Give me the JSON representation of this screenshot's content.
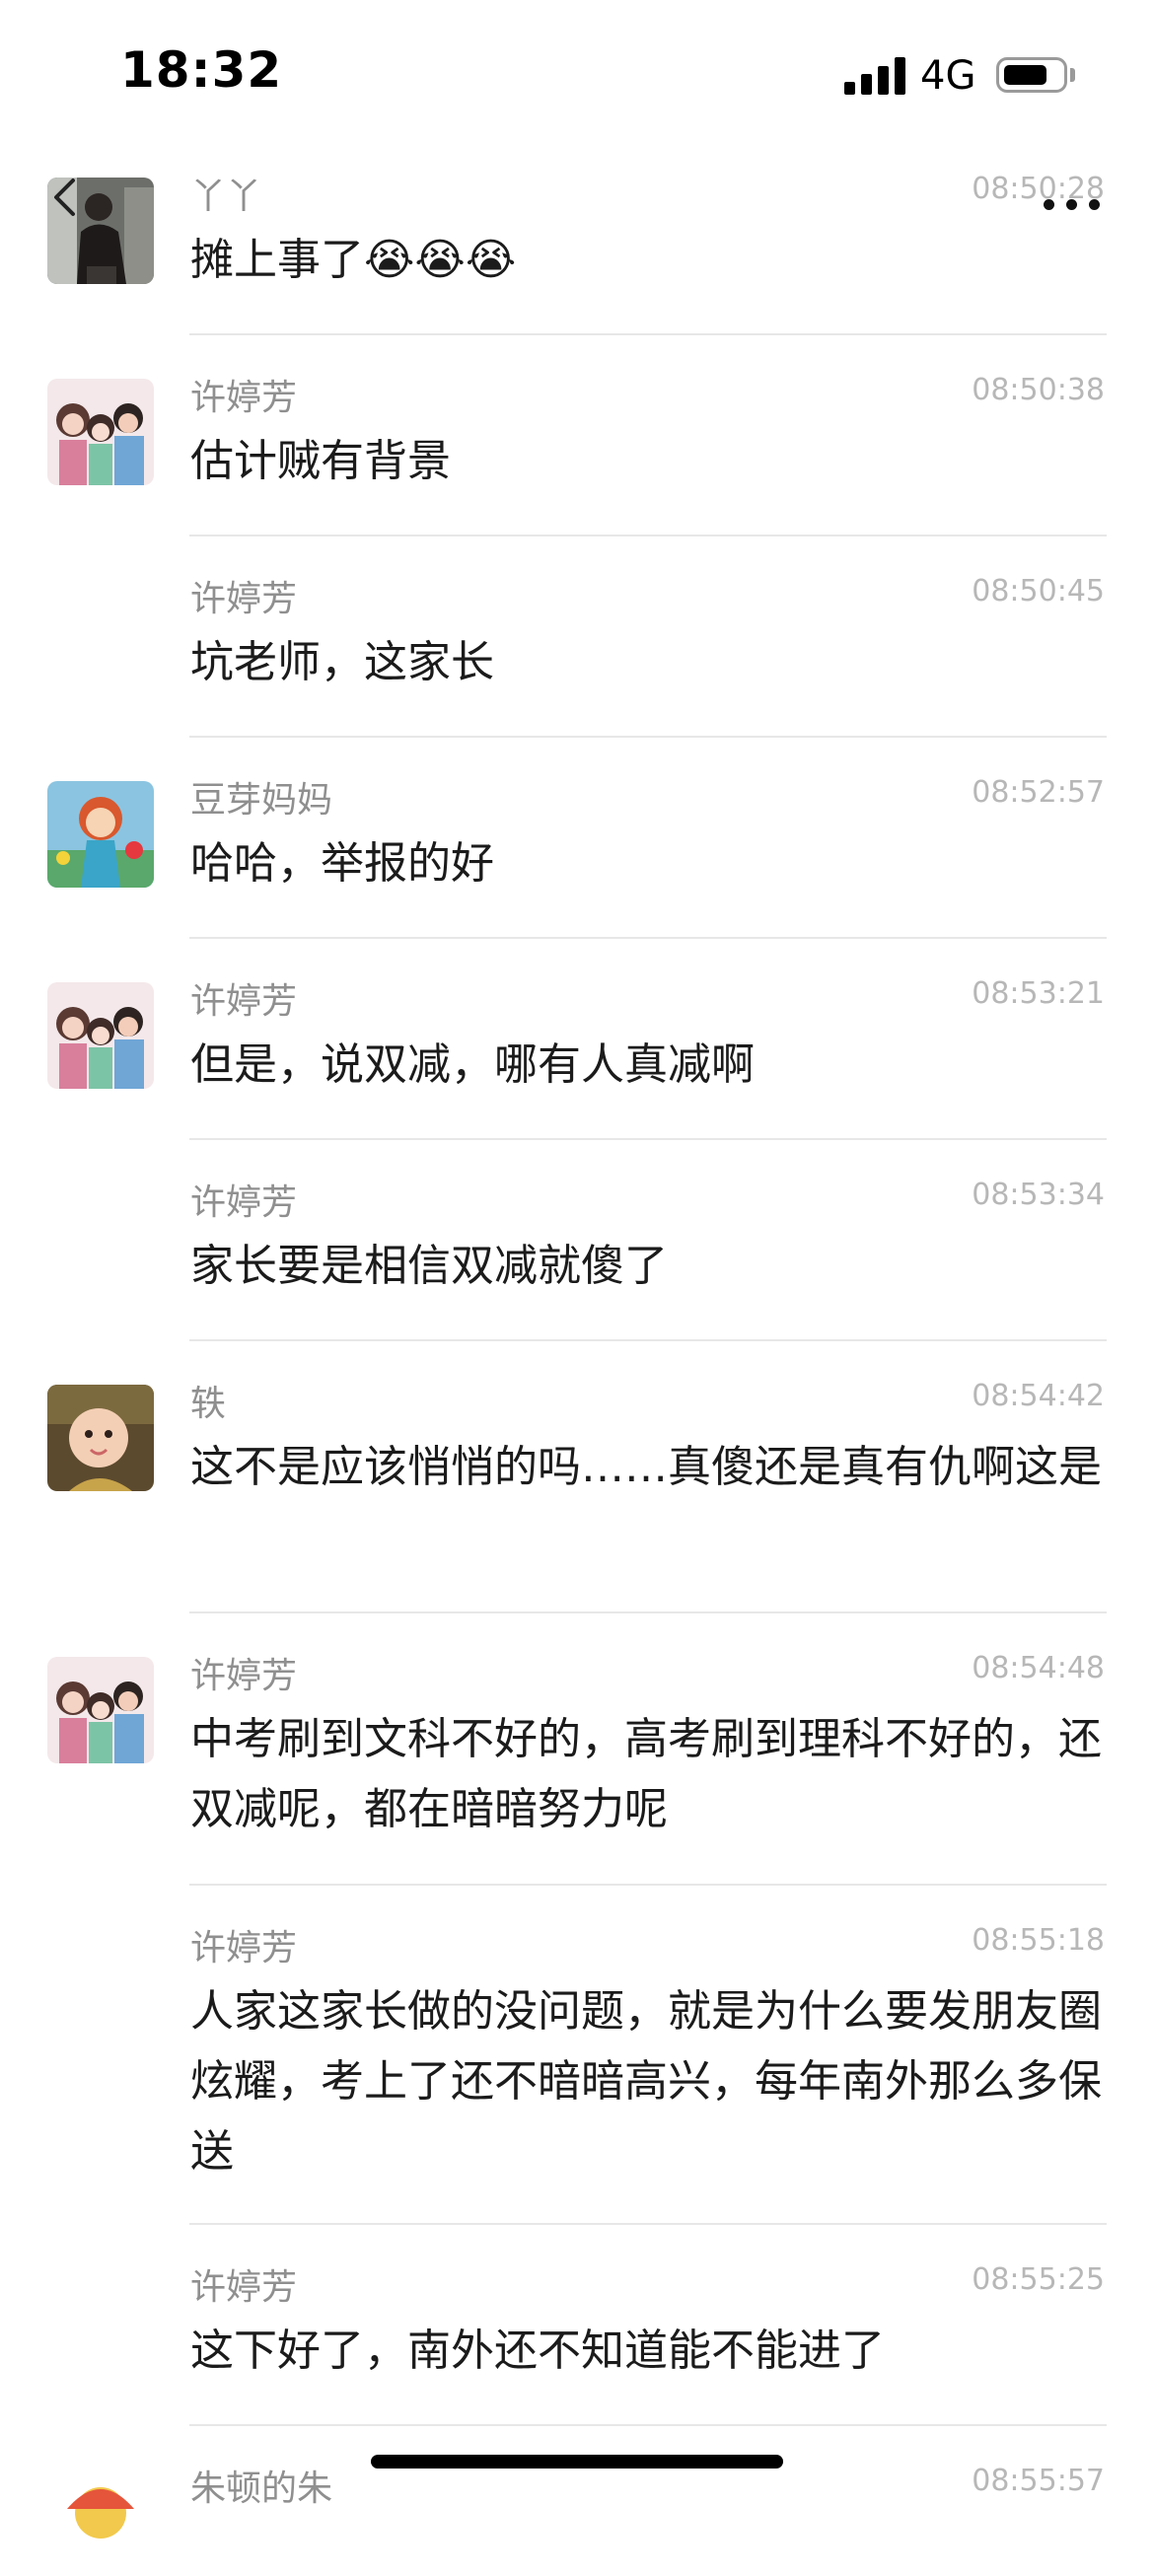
{
  "status": {
    "time": "18:32",
    "network": "4G"
  },
  "messages": [
    {
      "sender": "丫丫",
      "time": "08:50:28",
      "text": "摊上事了😭😭😭",
      "avatar": "photo-man-avatar"
    },
    {
      "sender": "许婷芳",
      "time": "08:50:38",
      "text": "估计贼有背景",
      "avatar": "family-cartoon-avatar"
    },
    {
      "sender": "许婷芳",
      "time": "08:50:45",
      "text": "坑老师，这家长",
      "avatar": ""
    },
    {
      "sender": "豆芽妈妈",
      "time": "08:52:57",
      "text": "哈哈，举报的好",
      "avatar": "girl-cartoon-avatar"
    },
    {
      "sender": "许婷芳",
      "time": "08:53:21",
      "text": "但是，说双减，哪有人真减啊",
      "avatar": "family-cartoon-avatar"
    },
    {
      "sender": "许婷芳",
      "time": "08:53:34",
      "text": "家长要是相信双减就傻了",
      "avatar": ""
    },
    {
      "sender": "轶",
      "time": "08:54:42",
      "text": "这不是应该悄悄的吗……真傻还是真有仇啊这是",
      "avatar": "baby-photo-avatar"
    },
    {
      "sender": "许婷芳",
      "time": "08:54:48",
      "text": "中考刷到文科不好的，高考刷到理科不好的，还双减呢，都在暗暗努力呢",
      "avatar": "family-cartoon-avatar"
    },
    {
      "sender": "许婷芳",
      "time": "08:55:18",
      "text": "人家这家长做的没问题，就是为什么要发朋友圈炫耀，考上了还不暗暗高兴，每年南外那么多保送",
      "avatar": ""
    },
    {
      "sender": "许婷芳",
      "time": "08:55:25",
      "text": "这下好了，南外还不知道能不能进了",
      "avatar": ""
    },
    {
      "sender": "朱顿的朱",
      "time": "08:55:57",
      "text": "",
      "avatar": "cartoon-avatar"
    }
  ]
}
